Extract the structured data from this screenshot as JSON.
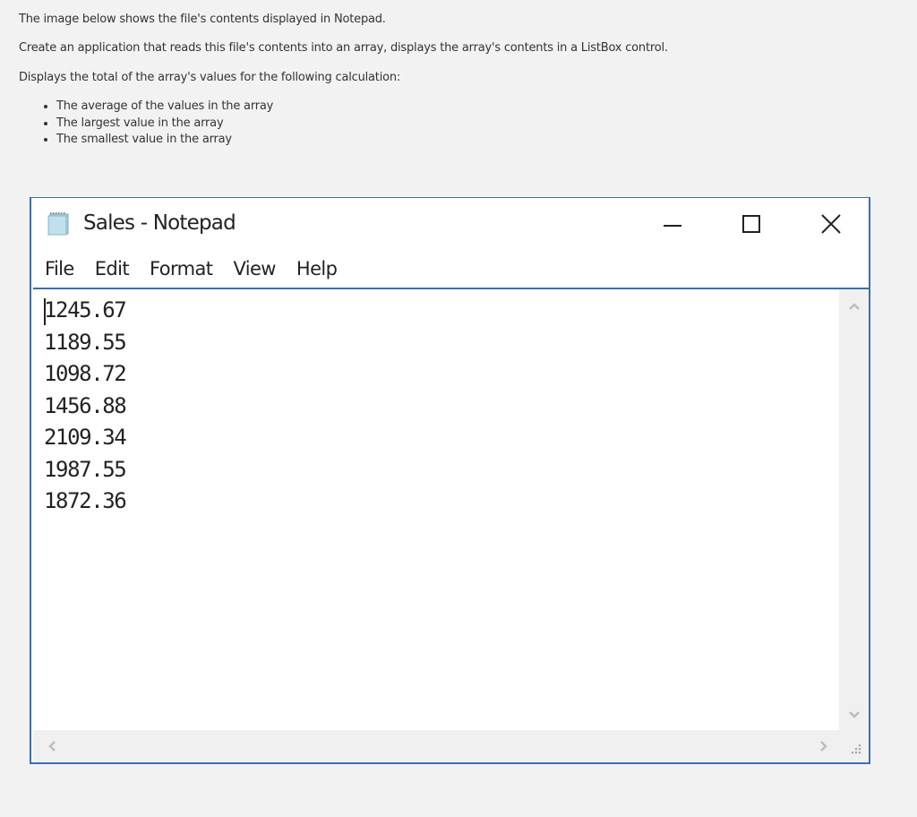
{
  "prompt": {
    "line1": "The image below shows the file's contents displayed in Notepad.",
    "line2": "Create an application that reads this file's contents into an array, displays the array's contents in a ListBox control.",
    "line3": "Displays the total of the array's values for the following calculation:",
    "bullets": [
      "The average of the values in the array",
      "The largest value in the array",
      "The smallest value in the array"
    ]
  },
  "notepad": {
    "title": "Sales - Notepad",
    "icon": "notepad-icon",
    "window_controls": {
      "minimize": "minimize-icon",
      "maximize": "maximize-icon",
      "close": "close-icon"
    },
    "menu": [
      "File",
      "Edit",
      "Format",
      "View",
      "Help"
    ],
    "lines": [
      "1245.67",
      "1189.55",
      "1098.72",
      "1456.88",
      "2109.34",
      "1987.55",
      "1872.36"
    ],
    "scrollbar_icons": {
      "up": "chevron-up-icon",
      "down": "chevron-down-icon",
      "left": "chevron-left-icon",
      "right": "chevron-right-icon",
      "grip": "resize-grip-icon"
    }
  },
  "colors": {
    "window_border": "#3c6eb4",
    "page_bg": "#f2f2f2",
    "scrollbar_bg": "#f0f0f0"
  }
}
